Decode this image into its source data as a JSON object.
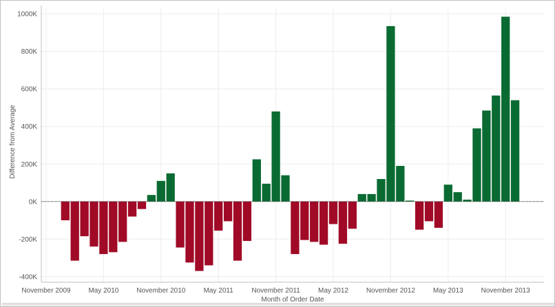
{
  "chart_data": {
    "type": "bar",
    "xlabel": "Month of Order Date",
    "ylabel": "Difference from Average",
    "ylim": [
      -430000,
      1030000
    ],
    "y_ticks": [
      {
        "value": 1000000,
        "label": "1000K"
      },
      {
        "value": 800000,
        "label": "800K"
      },
      {
        "value": 600000,
        "label": "600K"
      },
      {
        "value": 400000,
        "label": "400K"
      },
      {
        "value": 200000,
        "label": "200K"
      },
      {
        "value": 0,
        "label": "0K"
      },
      {
        "value": -200000,
        "label": "-200K"
      },
      {
        "value": -400000,
        "label": "-400K"
      }
    ],
    "x_ticks": [
      {
        "month": "2009-11",
        "label": "November 2009"
      },
      {
        "month": "2010-05",
        "label": "May 2010"
      },
      {
        "month": "2010-11",
        "label": "November 2010"
      },
      {
        "month": "2011-05",
        "label": "May 2011"
      },
      {
        "month": "2011-11",
        "label": "November 2011"
      },
      {
        "month": "2012-05",
        "label": "May 2012"
      },
      {
        "month": "2012-11",
        "label": "November 2012"
      },
      {
        "month": "2013-05",
        "label": "May 2013"
      },
      {
        "month": "2013-11",
        "label": "November 2013"
      }
    ],
    "grid": true,
    "zero_line": "dotted",
    "colors": {
      "positive": "#0a6b32",
      "negative": "#a00a26",
      "grid": "#ececec",
      "axis": "#bfbfbf"
    },
    "series": [
      {
        "months": [
          "2010-01",
          "2010-02",
          "2010-03",
          "2010-04",
          "2010-05",
          "2010-06",
          "2010-07",
          "2010-08",
          "2010-09",
          "2010-10",
          "2010-11",
          "2010-12",
          "2011-01",
          "2011-02",
          "2011-03",
          "2011-04",
          "2011-05",
          "2011-06",
          "2011-07",
          "2011-08",
          "2011-09",
          "2011-10",
          "2011-11",
          "2011-12",
          "2012-01",
          "2012-02",
          "2012-03",
          "2012-04",
          "2012-05",
          "2012-06",
          "2012-07",
          "2012-08",
          "2012-09",
          "2012-10",
          "2012-11",
          "2012-12",
          "2013-01",
          "2013-02",
          "2013-03",
          "2013-04",
          "2013-05",
          "2013-06",
          "2013-07",
          "2013-08",
          "2013-09",
          "2013-10",
          "2013-11",
          "2013-12"
        ],
        "values": [
          -100000,
          -315000,
          -185000,
          -240000,
          -280000,
          -270000,
          -215000,
          -80000,
          -40000,
          35000,
          110000,
          150000,
          -245000,
          -325000,
          -370000,
          -340000,
          -155000,
          -105000,
          -315000,
          -210000,
          225000,
          95000,
          480000,
          140000,
          -280000,
          -205000,
          -215000,
          -230000,
          -120000,
          -225000,
          -145000,
          40000,
          40000,
          120000,
          935000,
          190000,
          5000,
          -150000,
          -105000,
          -140000,
          90000,
          50000,
          10000,
          390000,
          485000,
          565000,
          985000,
          540000
        ]
      }
    ]
  }
}
